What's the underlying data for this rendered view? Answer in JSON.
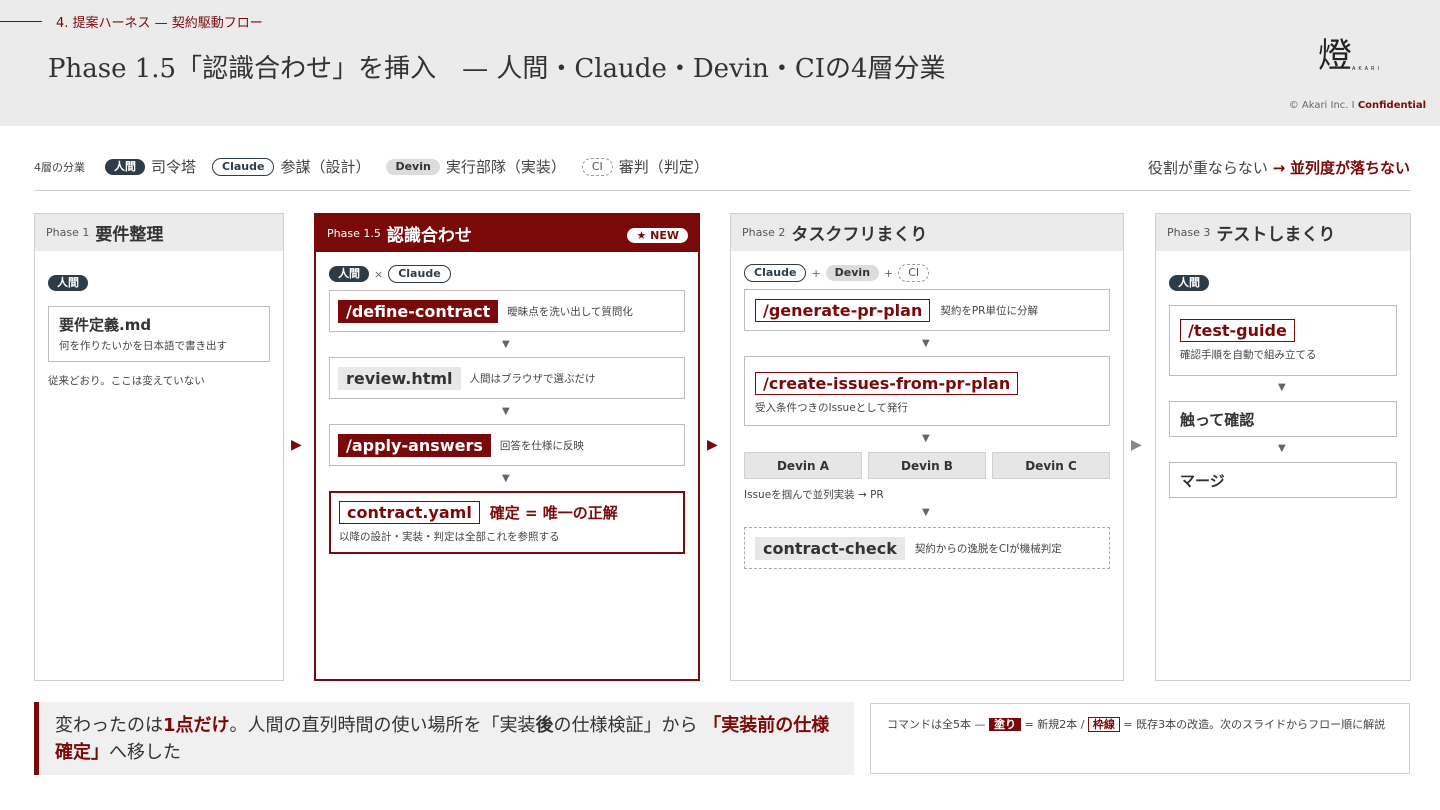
{
  "header": {
    "section": "4. 提案ハーネス — 契約駆動フロー",
    "title": "Phase 1.5「認識合わせ」を挿入　— 人間・Claude・Devin・CIの4層分業",
    "logo_glyph": "燈",
    "logo_text": "AKARI",
    "copyright": "© Akari Inc. I",
    "confidential": "Confidential"
  },
  "legend": {
    "label": "4層の分業",
    "items": [
      {
        "pill": "人間",
        "desc": "司令塔"
      },
      {
        "pill": "Claude",
        "desc": "参謀（設計）"
      },
      {
        "pill": "Devin",
        "desc": "実行部隊（実装）"
      },
      {
        "pill": "CI",
        "desc": "審判（判定）"
      }
    ],
    "tagline_prefix": "役割が重ならない",
    "tagline_arrow": "→",
    "tagline_strong": "並列度が落ちない"
  },
  "phase1": {
    "num": "Phase 1",
    "name": "要件整理",
    "actor": "人間",
    "card_title": "要件定義.md",
    "card_note": "何を作りたいかを日本語で書き出す",
    "note": "従来どおり。ここは変えていない"
  },
  "phase15": {
    "num": "Phase 1.5",
    "name": "認識合わせ",
    "badge": "★ NEW",
    "actor1": "人間",
    "times": "×",
    "actor2": "Claude",
    "step1_cmd": "/define-contract",
    "step1_note": "曖昧点を洗い出して質問化",
    "step2_cmd": "review.html",
    "step2_note": "人間はブラウザで選ぶだけ",
    "step3_cmd": "/apply-answers",
    "step3_note": "回答を仕様に反映",
    "step4_cmd": "contract.yaml",
    "step4_title": "確定 = 唯一の正解",
    "step4_note": "以降の設計・実装・判定は全部これを参照する"
  },
  "phase2": {
    "num": "Phase 2",
    "name": "タスクフリまくり",
    "actor1": "Claude",
    "actor2": "Devin",
    "actor3": "CI",
    "plus": "+",
    "step1_cmd": "/generate-pr-plan",
    "step1_note": "契約をPR単位に分解",
    "step2_cmd": "/create-issues-from-pr-plan",
    "step2_note": "受入条件つきのIssueとして発行",
    "devins": [
      "Devin A",
      "Devin B",
      "Devin C"
    ],
    "devin_note": "Issueを掴んで並列実装 → PR",
    "step3_cmd": "contract-check",
    "step3_note": "契約からの逸脱をCIが機械判定"
  },
  "phase3": {
    "num": "Phase 3",
    "name": "テストしまくり",
    "actor": "人間",
    "step1_cmd": "/test-guide",
    "step1_note": "確認手順を自動で組み立てる",
    "step2_title": "触って確認",
    "step3_title": "マージ"
  },
  "arrows": {
    "down": "▼",
    "right": "▶"
  },
  "bottom": {
    "p1": "変わったのは",
    "p2": "1点だけ",
    "p3": "。人間の直列時間の使い場所を「実装",
    "p4": "後",
    "p5": "の仕様検証」から ",
    "p6": "「実装前の仕様確定」",
    "p7": "へ移した",
    "note_a": "コマンドは全5本 —",
    "note_fill": "塗り",
    "note_b": "= 新規2本 /",
    "note_outline": "枠線",
    "note_c": "= 既存3本の改造。次のスライドからフロー順に解説"
  },
  "colors": {
    "accent": "#7a0a0a",
    "navy": "#2e3c47",
    "header_bg": "#ebebeb"
  }
}
